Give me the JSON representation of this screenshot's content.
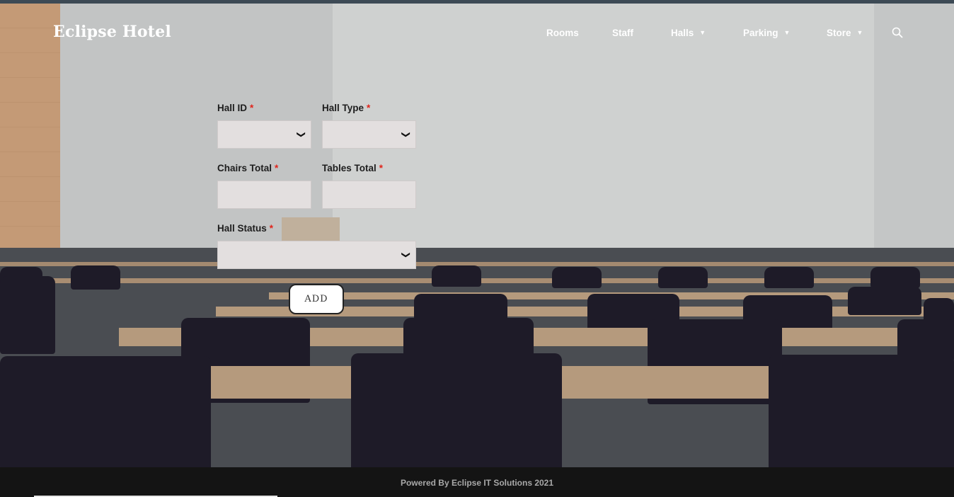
{
  "header": {
    "brand": "Eclipse Hotel",
    "nav": [
      {
        "label": "Rooms",
        "has_dropdown": false
      },
      {
        "label": "Staff",
        "has_dropdown": false
      },
      {
        "label": "Halls",
        "has_dropdown": true
      },
      {
        "label": "Parking",
        "has_dropdown": true
      },
      {
        "label": "Store",
        "has_dropdown": true
      }
    ],
    "search_icon": "search-icon"
  },
  "form": {
    "hall_id": {
      "label": "Hall ID",
      "value": ""
    },
    "hall_type": {
      "label": "Hall Type",
      "value": ""
    },
    "chairs_total": {
      "label": "Chairs Total",
      "value": ""
    },
    "tables_total": {
      "label": "Tables Total",
      "value": ""
    },
    "hall_status": {
      "label": "Hall Status",
      "value": ""
    },
    "required_mark": "*",
    "submit_label": "ADD"
  },
  "footer": {
    "text": "Powered By Eclipse IT Solutions 2021"
  },
  "colors": {
    "required": "#e0241b",
    "field_bg": "#e3dfdf",
    "footer_bg": "#141414"
  }
}
